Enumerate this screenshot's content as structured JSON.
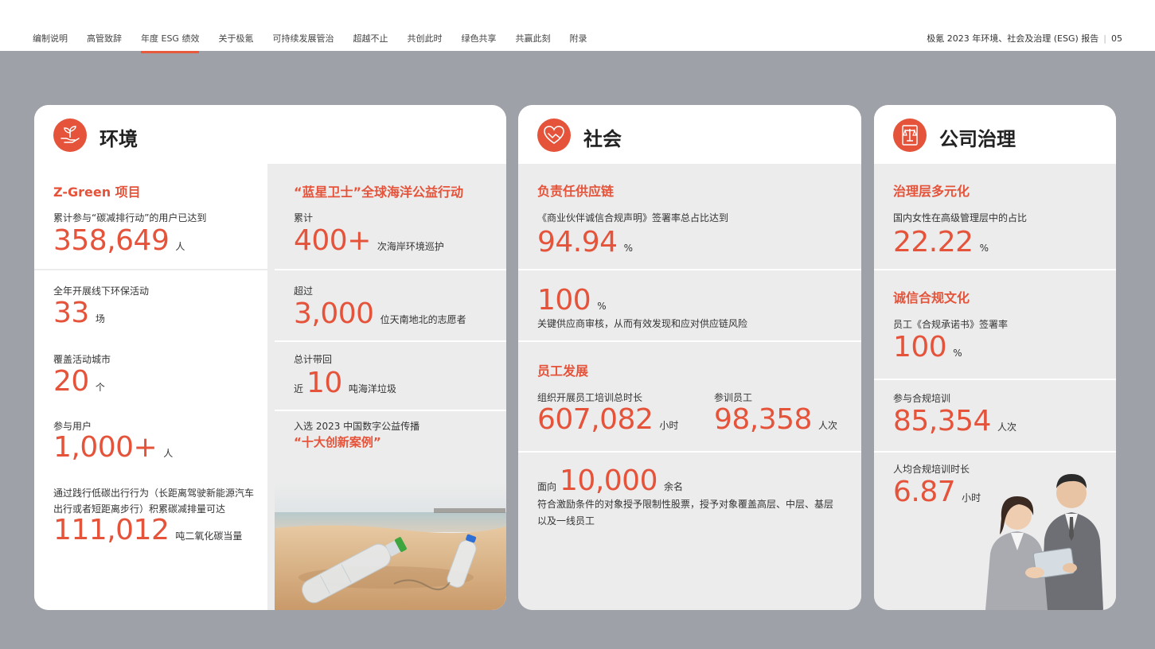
{
  "nav": {
    "items": [
      "编制说明",
      "高管致辞",
      "年度 ESG 绩效",
      "关于极氪",
      "可持续发展管治",
      "超越不止",
      "共创此时",
      "绿色共享",
      "共赢此刻",
      "附录"
    ],
    "active_index": 2
  },
  "report": {
    "title": "极氪 2023 年环境、社会及治理 (ESG) 报告",
    "page": "05"
  },
  "colors": {
    "accent": "#e4533a",
    "background": "#9ea1a7",
    "card": "#ececec"
  },
  "environment": {
    "icon": "seedling-hand-icon",
    "title": "环境",
    "zgreen": {
      "title": "Z-Green 项目",
      "users_label": "累计参与“碳减排行动”的用户已达到",
      "users_value": "358,649",
      "users_unit": "人",
      "events_label": "全年开展线下环保活动",
      "events_value": "33",
      "events_unit": "场",
      "cities_label": "覆盖活动城市",
      "cities_value": "20",
      "cities_unit": "个",
      "participants_label": "参与用户",
      "participants_value": "1,000+",
      "participants_unit": "人",
      "carbon_label_1": "通过践行低碳出行行为（长距离驾驶新能源汽车",
      "carbon_label_2": "出行或者短距离步行）积累碳减排量可达",
      "carbon_value": "111,012",
      "carbon_unit": "吨二氧化碳当量"
    },
    "blue_star": {
      "title": "“蓝星卫士”全球海洋公益行动",
      "patrol_label": "累计",
      "patrol_value": "400+",
      "patrol_unit": "次海岸环境巡护",
      "volunteers_label": "超过",
      "volunteers_value": "3,000",
      "volunteers_unit": "位天南地北的志愿者",
      "garbage_label": "总计带回",
      "garbage_prefix": "近",
      "garbage_value": "10",
      "garbage_unit": "吨海洋垃圾",
      "award_label": "入选 2023 中国数字公益传播",
      "award_name": "“十大创新案例”"
    }
  },
  "society": {
    "icon": "heart-handshake-icon",
    "title": "社会",
    "supply": {
      "title": "负责任供应链",
      "sign_label": "《商业伙伴诚信合规声明》签署率总占比达到",
      "sign_value": "94.94",
      "sign_unit": "%",
      "audit_value": "100",
      "audit_unit": "%",
      "audit_label": "关键供应商审核，从而有效发现和应对供应链风险"
    },
    "employee": {
      "title": "员工发展",
      "hours_label": "组织开展员工培训总时长",
      "hours_value": "607,082",
      "hours_unit": "小时",
      "trained_label": "参训员工",
      "trained_value": "98,358",
      "trained_unit": "人次",
      "stock_prefix": "面向",
      "stock_value": "10,000",
      "stock_unit": "余名",
      "stock_note": "符合激励条件的对象授予限制性股票，授予对象覆盖高层、中层、基层以及一线员工"
    }
  },
  "governance": {
    "icon": "scales-document-icon",
    "title": "公司治理",
    "diversity": {
      "title": "治理层多元化",
      "women_label": "国内女性在高级管理层中的占比",
      "women_value": "22.22",
      "women_unit": "%"
    },
    "integrity": {
      "title": "诚信合规文化",
      "pledge_label": "员工《合规承诺书》签署率",
      "pledge_value": "100",
      "pledge_unit": "%",
      "training_label": "参与合规培训",
      "training_value": "85,354",
      "training_unit": "人次",
      "avg_label": "人均合规培训时长",
      "avg_value": "6.87",
      "avg_unit": "小时"
    }
  }
}
